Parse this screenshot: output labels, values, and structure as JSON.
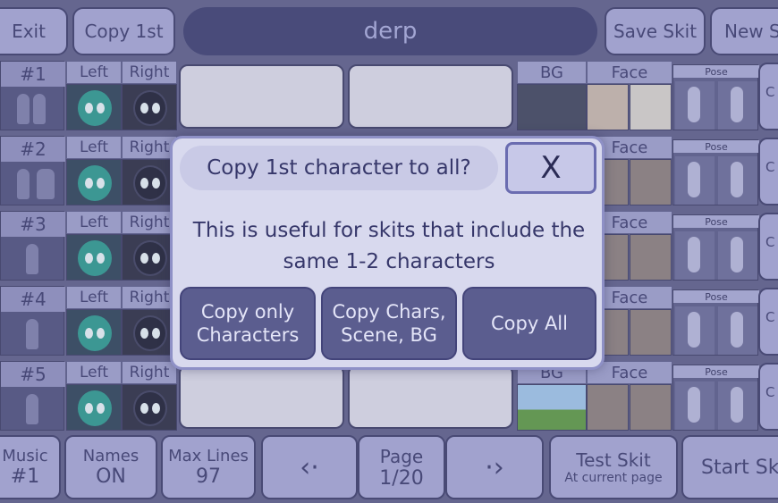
{
  "header": {
    "exit_label": "Exit",
    "copy_first_label": "Copy 1st",
    "skit_title": "derp",
    "save_label": "Save Skit",
    "new_label": "New S"
  },
  "columns": {
    "left": "Left",
    "right": "Right",
    "bg": "BG",
    "face": "Face",
    "pose": "Pose",
    "edge": "C"
  },
  "rows": [
    {
      "num": "#1"
    },
    {
      "num": "#2"
    },
    {
      "num": "#3"
    },
    {
      "num": "#4"
    },
    {
      "num": "#5"
    }
  ],
  "bottom": {
    "music_top": "Music",
    "music_val": "#1",
    "names_top": "Names",
    "names_val": "ON",
    "maxlines_top": "Max Lines",
    "maxlines_val": "97",
    "prev_icon": "‹·",
    "page_top": "Page",
    "page_val": "1/20",
    "next_icon": "·›",
    "test_top": "Test Skit",
    "test_sub": "At current page",
    "start_label": "Start Sk"
  },
  "modal": {
    "title": "Copy 1st character to all?",
    "close": "X",
    "body": "This is useful for skits that include the same 1-2 characters",
    "btn_chars": "Copy only Characters",
    "btn_scene": "Copy Chars, Scene, BG",
    "btn_all": "Copy All"
  },
  "colors": {
    "accent": "#5b5d8f",
    "panel": "#a6a8d2",
    "background": "#5d5f86"
  }
}
